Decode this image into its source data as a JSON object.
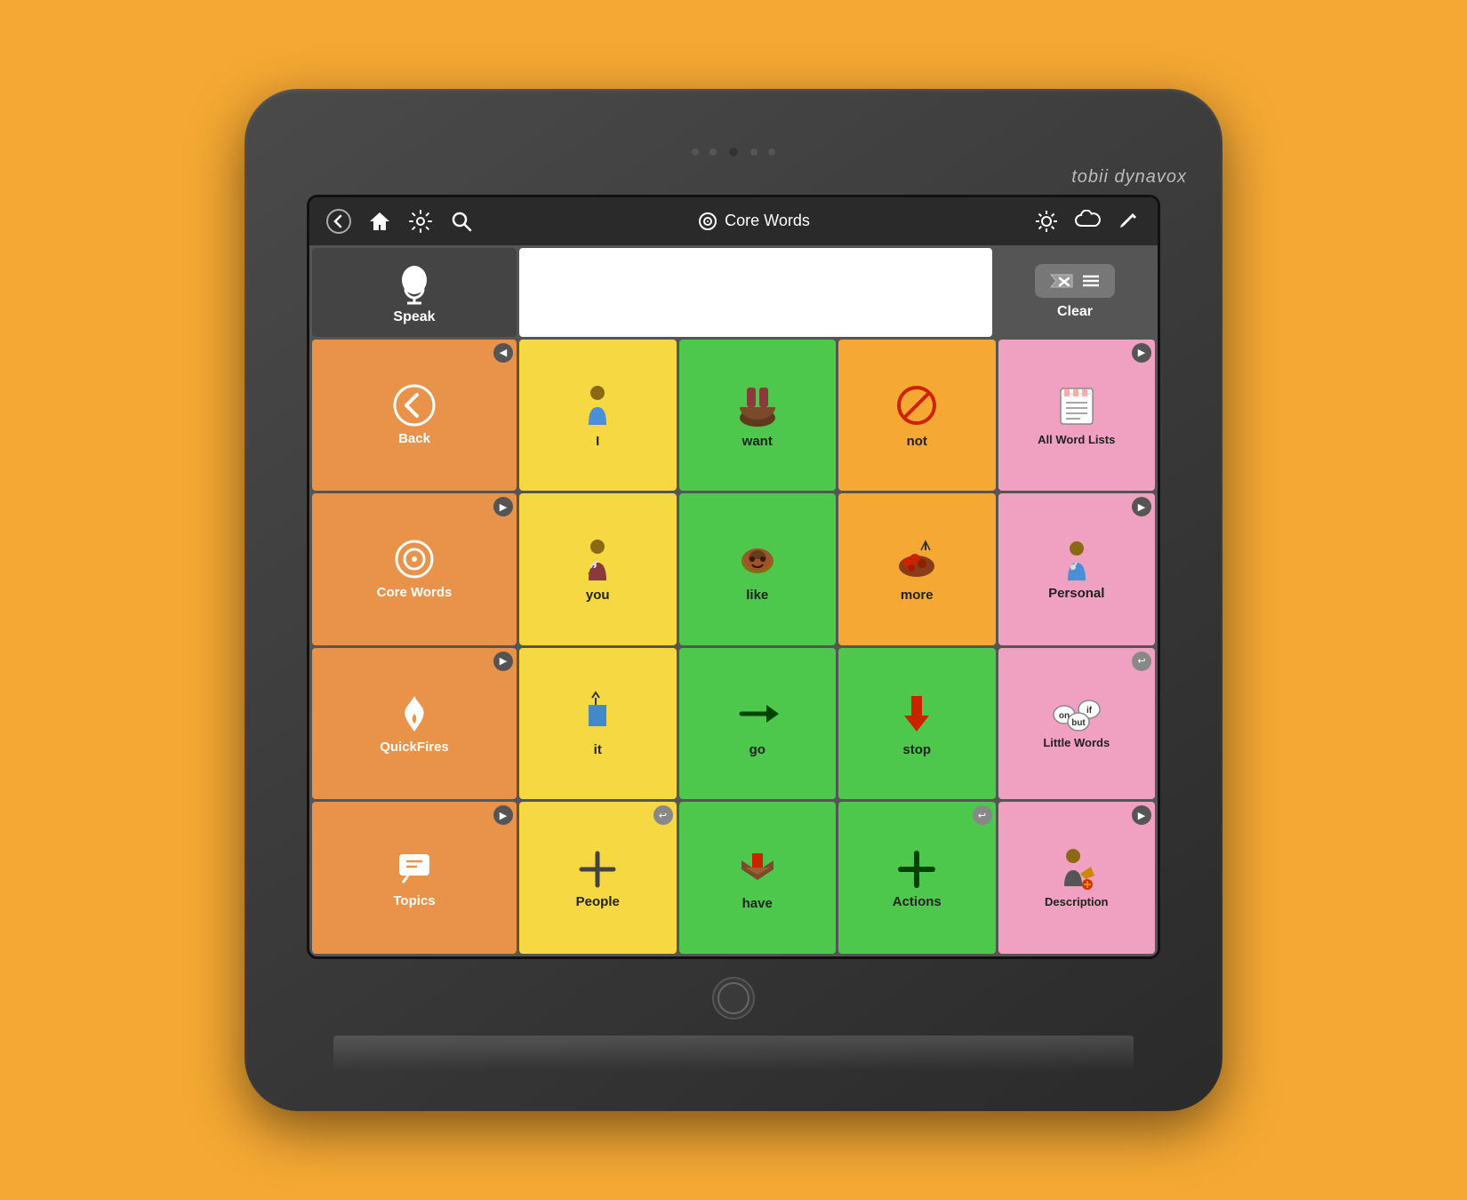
{
  "brand": "tobii dynavox",
  "nav": {
    "title": "Core Words",
    "icons": [
      "back-arrow",
      "home",
      "settings",
      "search"
    ]
  },
  "toolbar": {
    "speak_label": "Speak",
    "clear_label": "Clear"
  },
  "sidebar": [
    {
      "id": "back",
      "label": "Back",
      "color": "orange",
      "icon": "back-arrow"
    },
    {
      "id": "core-words",
      "label": "Core Words",
      "color": "orange",
      "icon": "target"
    },
    {
      "id": "quickfires",
      "label": "QuickFires",
      "color": "orange",
      "icon": "flame"
    },
    {
      "id": "topics",
      "label": "Topics",
      "color": "orange",
      "icon": "chat"
    }
  ],
  "cells": [
    {
      "id": "i",
      "label": "I",
      "color": "yellow",
      "icon": "person-i"
    },
    {
      "id": "want",
      "label": "want",
      "color": "green",
      "icon": "hands-want"
    },
    {
      "id": "not",
      "label": "not",
      "color": "orange-med",
      "icon": "no-sign"
    },
    {
      "id": "all-word-lists",
      "label": "All Word Lists",
      "color": "pink",
      "icon": "notepad",
      "arrow": "right"
    },
    {
      "id": "you",
      "label": "you",
      "color": "yellow",
      "icon": "person-you"
    },
    {
      "id": "like",
      "label": "like",
      "color": "green",
      "icon": "potato-like"
    },
    {
      "id": "more",
      "label": "more",
      "color": "orange-med",
      "icon": "berries-more"
    },
    {
      "id": "personal",
      "label": "Personal",
      "color": "pink",
      "icon": "person-personal",
      "arrow": "right"
    },
    {
      "id": "it",
      "label": "it",
      "color": "yellow",
      "icon": "box-it"
    },
    {
      "id": "go",
      "label": "go",
      "color": "green",
      "icon": "arrow-go"
    },
    {
      "id": "stop",
      "label": "stop",
      "color": "green",
      "icon": "hand-stop"
    },
    {
      "id": "little-words",
      "label": "Little Words",
      "color": "pink",
      "icon": "bubbles-lw",
      "arrow": "left"
    },
    {
      "id": "people",
      "label": "People",
      "color": "yellow",
      "icon": "plus-people",
      "arrow": "left"
    },
    {
      "id": "have",
      "label": "have",
      "color": "green",
      "icon": "hand-have"
    },
    {
      "id": "actions",
      "label": "Actions",
      "color": "green",
      "icon": "plus-actions",
      "arrow": "left"
    },
    {
      "id": "description",
      "label": "Description",
      "color": "pink",
      "icon": "person-fire",
      "arrow": "right"
    }
  ]
}
